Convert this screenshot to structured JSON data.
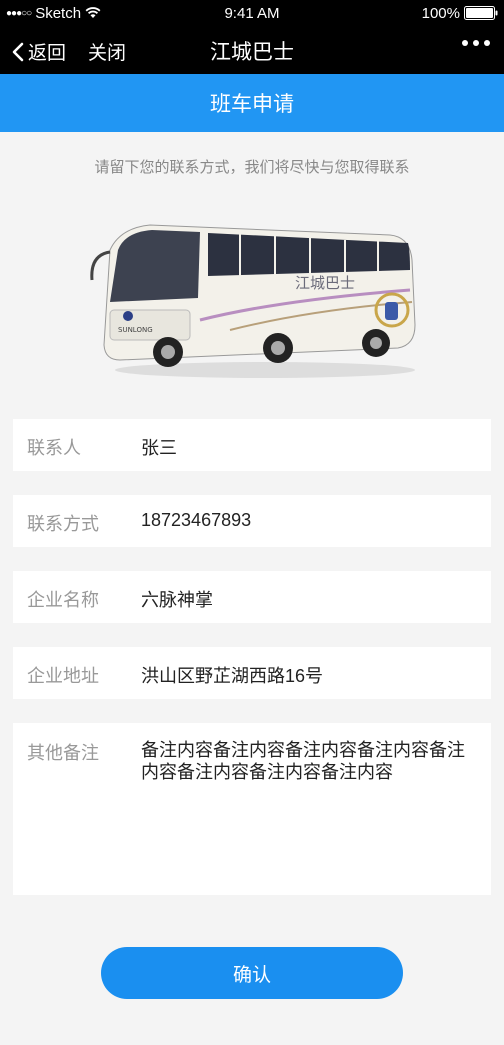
{
  "status_bar": {
    "carrier": "Sketch",
    "time": "9:41 AM",
    "battery": "100%"
  },
  "nav": {
    "back_label": "返回",
    "close_label": "关闭",
    "title": "江城巴士"
  },
  "header": {
    "title": "班车申请"
  },
  "subtitle": "请留下您的联系方式，我们将尽快与您取得联系",
  "bus": {
    "side_text": "江城巴士",
    "brand_text": "SUNLONG",
    "body_color": "#f3f1ea",
    "stripe_color": "#b88ec0"
  },
  "form": {
    "contact_label": "联系人",
    "contact_value": "张三",
    "phone_label": "联系方式",
    "phone_value": "18723467893",
    "company_label": "企业名称",
    "company_value": "六脉神掌",
    "address_label": "企业地址",
    "address_value": "洪山区野芷湖西路16号",
    "notes_label": "其他备注",
    "notes_value": "备注内容备注内容备注内容备注内容备注内容备注内容备注内容备注内容"
  },
  "confirm_label": "确认",
  "colors": {
    "primary": "#2196f3",
    "button": "#1a8ff0",
    "background": "#f4f4f4"
  }
}
